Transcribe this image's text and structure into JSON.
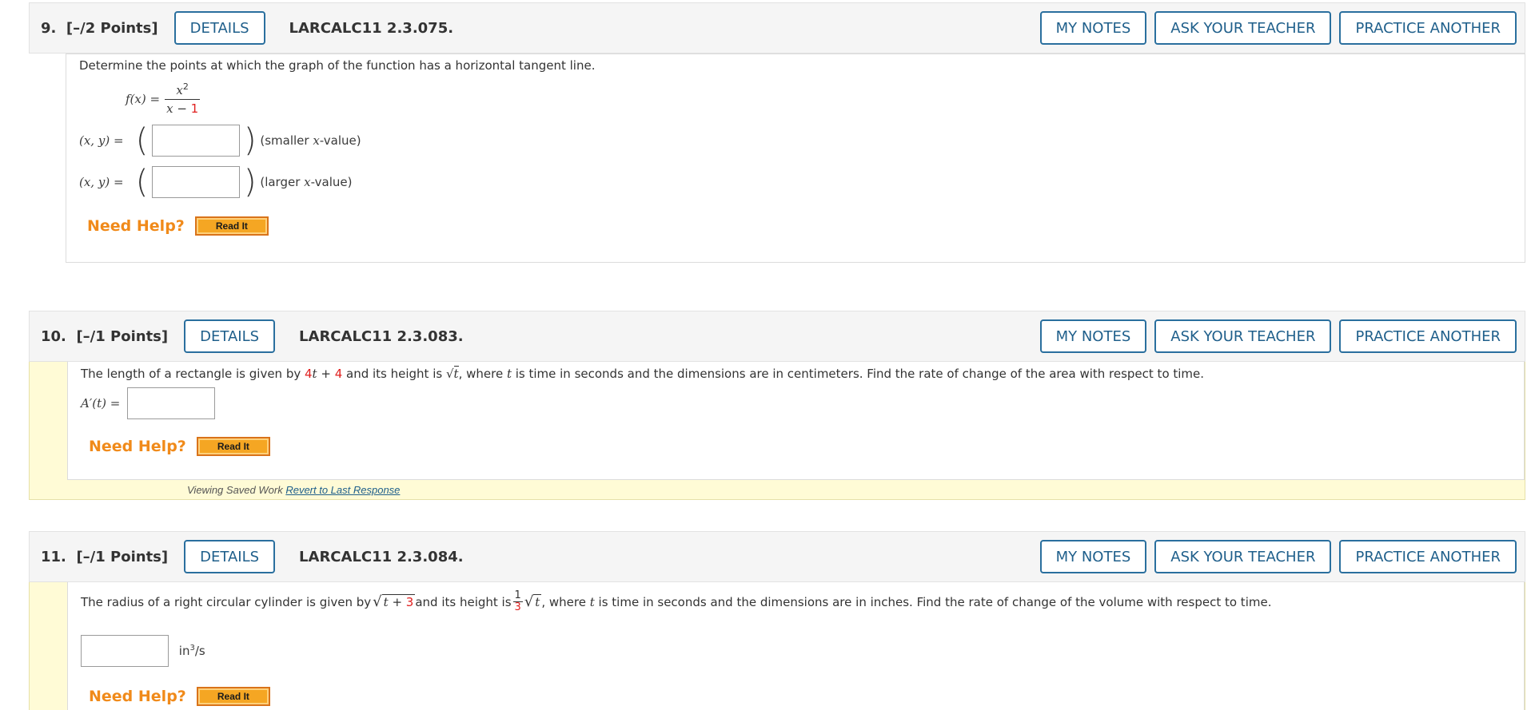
{
  "q9": {
    "number": "9.",
    "points": "[–/2 Points]",
    "details": "DETAILS",
    "code": "LARCALC11 2.3.075.",
    "my_notes": "MY NOTES",
    "ask_teacher": "ASK YOUR TEACHER",
    "practice": "PRACTICE ANOTHER",
    "prompt": "Determine the points at which the graph of the function has a horizontal tangent line.",
    "func_lhs": "f(x) =",
    "func_num": "x",
    "func_num_exp": "2",
    "func_den_var": "x",
    "func_den_op": "−",
    "func_den_const": "1",
    "pair_label": "(x, y)  =",
    "ans1_suffix_pre": "(smaller ",
    "ans1_suffix_var": "x",
    "ans1_suffix_post": "-value)",
    "ans2_suffix_pre": "(larger ",
    "ans2_suffix_var": "x",
    "ans2_suffix_post": "-value)",
    "need_help": "Need Help?",
    "read_it": "Read It"
  },
  "q10": {
    "number": "10.",
    "points": "[–/1 Points]",
    "details": "DETAILS",
    "code": "LARCALC11 2.3.083.",
    "my_notes": "MY NOTES",
    "ask_teacher": "ASK YOUR TEACHER",
    "practice": "PRACTICE ANOTHER",
    "prompt_a": "The length of a rectangle is given by ",
    "prompt_4": "4",
    "prompt_t": "t",
    "prompt_plus": " + ",
    "prompt_4b": "4",
    "prompt_b": " and its height is ",
    "prompt_sqrt": "√",
    "prompt_t2": "t",
    "prompt_c": ", where ",
    "prompt_t3": "t",
    "prompt_d": " is time in seconds and the dimensions are in centimeters. Find the rate of change of the area with respect to time.",
    "ans_label": "A′(t)  =",
    "need_help": "Need Help?",
    "read_it": "Read It",
    "viewing": "Viewing Saved Work ",
    "revert": "Revert to Last Response"
  },
  "q11": {
    "number": "11.",
    "points": "[–/1 Points]",
    "details": "DETAILS",
    "code": "LARCALC11 2.3.084.",
    "my_notes": "MY NOTES",
    "ask_teacher": "ASK YOUR TEACHER",
    "practice": "PRACTICE ANOTHER",
    "prompt_a": "The radius of a right circular cylinder is given by ",
    "sqrt_t": "t",
    "sqrt_plus": " + ",
    "sqrt_3": "3",
    "prompt_b": " and its height is ",
    "frac_num": "1",
    "frac_den": "3",
    "sqrt2_t": "t",
    "prompt_c": ", where ",
    "prompt_t": "t",
    "prompt_d": " is time in seconds and the dimensions are in inches. Find the rate of change of the volume with respect to time.",
    "unit_base": "in",
    "unit_exp": "3",
    "unit_tail": "/s",
    "need_help": "Need Help?",
    "read_it": "Read It"
  }
}
